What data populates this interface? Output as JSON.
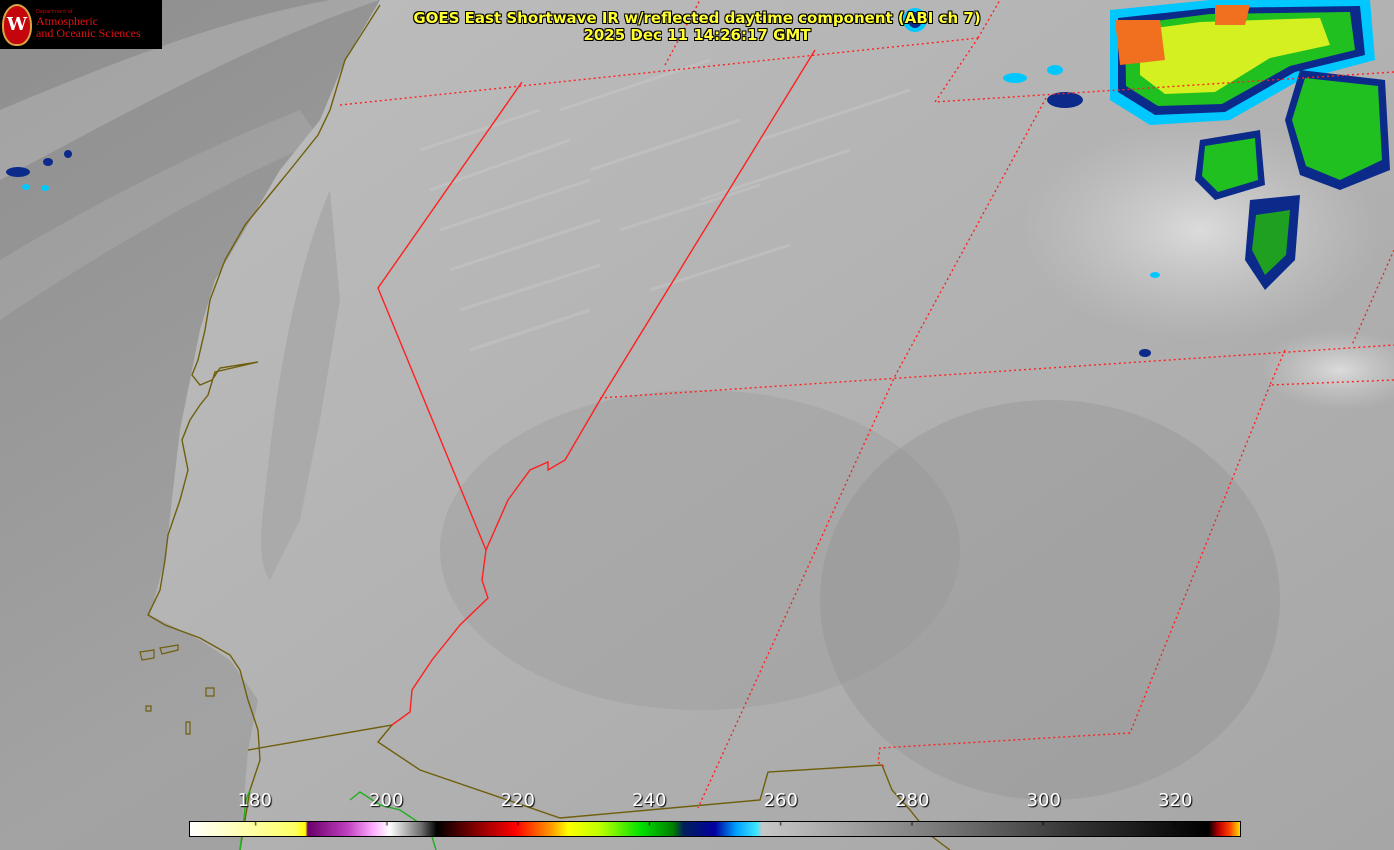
{
  "logo": {
    "dept": "Department of",
    "line1": "Atmospheric",
    "line2": "and Oceanic Sciences",
    "seal_letter": "W"
  },
  "title": {
    "line1": "GOES East Shortwave IR w/reflected daytime component (ABI ch 7)",
    "line2": "2025 Dec 11 14:26:17 GMT"
  },
  "colorbar": {
    "units_range": [
      170,
      330
    ],
    "ticks": [
      "180",
      "200",
      "220",
      "240",
      "260",
      "280",
      "300",
      "320"
    ],
    "tick_values": [
      180,
      200,
      220,
      240,
      260,
      280,
      300,
      320
    ]
  },
  "colors": {
    "state_border": "#ff2020",
    "coastline": "#7a6a10",
    "title_text": "#ffff33",
    "logo_red": "#c5050c"
  }
}
